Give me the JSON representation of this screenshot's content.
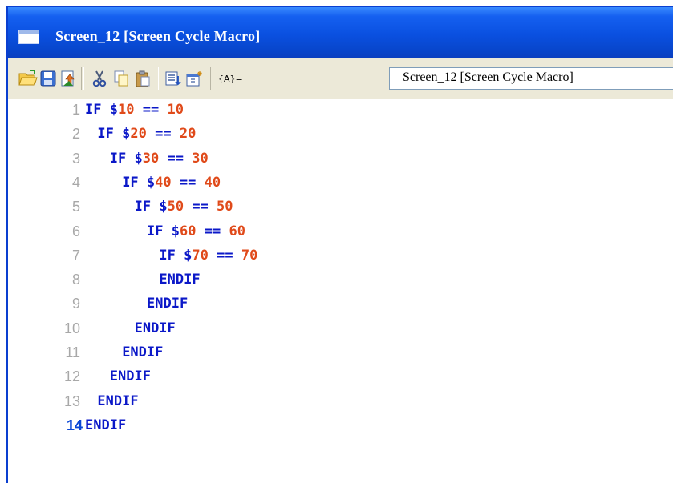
{
  "window": {
    "title": "Screen_12 [Screen Cycle Macro]"
  },
  "toolbar": {
    "buttons": [
      {
        "name": "open-folder-icon"
      },
      {
        "name": "save-icon"
      },
      {
        "name": "compile-icon"
      },
      {
        "name": "cut-icon"
      },
      {
        "name": "copy-icon"
      },
      {
        "name": "paste-icon"
      },
      {
        "name": "insert-command-icon"
      },
      {
        "name": "macro-properties-icon"
      }
    ],
    "label": "{A}=",
    "combo_value": "Screen_12 [Screen Cycle Macro]"
  },
  "editor": {
    "current_line": 14,
    "lines": [
      {
        "num": "1",
        "indent": 0,
        "kw": "IF",
        "var": "$10",
        "op": "==",
        "val": "10"
      },
      {
        "num": "2",
        "indent": 1,
        "kw": "IF",
        "var": "$20",
        "op": "==",
        "val": "20"
      },
      {
        "num": "3",
        "indent": 2,
        "kw": "IF",
        "var": "$30",
        "op": "==",
        "val": "30"
      },
      {
        "num": "4",
        "indent": 3,
        "kw": "IF",
        "var": "$40",
        "op": "==",
        "val": "40"
      },
      {
        "num": "5",
        "indent": 4,
        "kw": "IF",
        "var": "$50",
        "op": "==",
        "val": "50"
      },
      {
        "num": "6",
        "indent": 5,
        "kw": "IF",
        "var": "$60",
        "op": "==",
        "val": "60"
      },
      {
        "num": "7",
        "indent": 6,
        "kw": "IF",
        "var": "$70",
        "op": "==",
        "val": "70"
      },
      {
        "num": "8",
        "indent": 6,
        "kw": "ENDIF"
      },
      {
        "num": "9",
        "indent": 5,
        "kw": "ENDIF"
      },
      {
        "num": "10",
        "indent": 4,
        "kw": "ENDIF"
      },
      {
        "num": "11",
        "indent": 3,
        "kw": "ENDIF"
      },
      {
        "num": "12",
        "indent": 2,
        "kw": "ENDIF"
      },
      {
        "num": "13",
        "indent": 1,
        "kw": "ENDIF"
      },
      {
        "num": "14",
        "indent": 0,
        "kw": "ENDIF"
      }
    ]
  },
  "colors": {
    "titlebar": "#0a50e0",
    "keyword": "#0b18c8",
    "number": "#e04a1a",
    "line_number": "#a8a8a8",
    "current_line_number": "#0a47d6"
  }
}
